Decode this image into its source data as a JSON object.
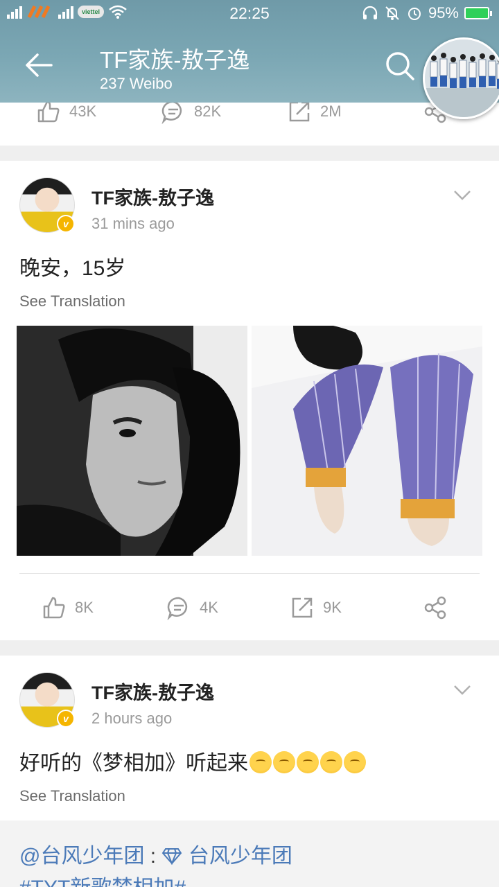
{
  "status_bar": {
    "carrier": "viettel",
    "time": "22:25",
    "battery": "95%"
  },
  "header": {
    "title": "TF家族-敖子逸",
    "subtitle": "237 Weibo"
  },
  "prev_post": {
    "likes": "43K",
    "comments": "82K",
    "reposts": "2M"
  },
  "posts": [
    {
      "author": "TF家族-敖子逸",
      "time": "31  mins ago",
      "text": "晚安，15岁",
      "see_translation": "See Translation",
      "likes": "8K",
      "comments": "4K",
      "reposts": "9K"
    },
    {
      "author": "TF家族-敖子逸",
      "time": "2 hours ago",
      "text": "好听的《梦相加》听起来",
      "see_translation": "See Translation",
      "quote_user": "@台风少年团",
      "quote_sep": " :",
      "quote_name": "台风少年团",
      "quote_tag": "#TYT新歌梦相加#"
    }
  ],
  "colors": {
    "header": "#7ba7b4",
    "link": "#4b7ab8",
    "verified": "#f5b500"
  }
}
